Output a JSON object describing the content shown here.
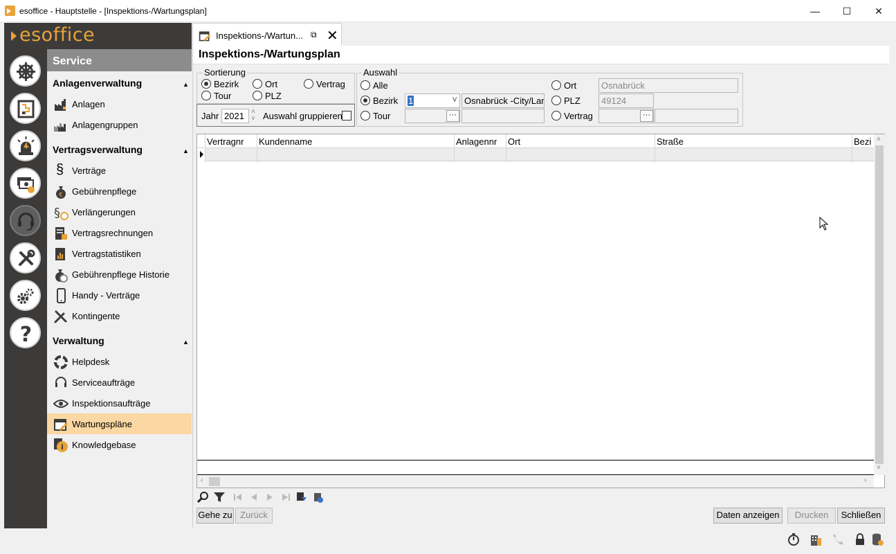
{
  "window": {
    "title": "esoffice - Hauptstelle - [Inspektions-/Wartungsplan]",
    "minimize": "—",
    "maximize": "☐",
    "close": "✕"
  },
  "brand": {
    "logo_text": "esoffice"
  },
  "rail": {
    "icons": [
      "helm-icon",
      "map-icon",
      "alarm-icon",
      "money-icon",
      "headset-icon",
      "tools-icon",
      "gears-icon",
      "help-icon"
    ]
  },
  "sidebar": {
    "section_title": "Service",
    "groups": [
      {
        "title": "Anlagenverwaltung",
        "items": [
          "Anlagen",
          "Anlagengruppen"
        ]
      },
      {
        "title": "Vertragsverwaltung",
        "items": [
          "Verträge",
          "Gebührenpflege",
          "Verlängerungen",
          "Vertragsrechnungen",
          "Vertragstatistiken",
          "Gebührenpflege Historie",
          "Handy - Verträge",
          "Kontingente"
        ]
      },
      {
        "title": "Verwaltung",
        "items": [
          "Helpdesk",
          "Serviceaufträge",
          "Inspektionsaufträge",
          "Wartungspläne",
          "Knowledgebase"
        ]
      }
    ],
    "caret": "▲",
    "section_symbol": "§"
  },
  "tab": {
    "label": "Inspektions-/Wartun...",
    "close": "✕",
    "popout": "⧉"
  },
  "page": {
    "title": "Inspektions-/Wartungsplan"
  },
  "sort": {
    "legend": "Sortierung",
    "options": [
      "Bezirk",
      "Ort",
      "Vertrag",
      "Tour",
      "PLZ"
    ],
    "selected": "Bezirk",
    "year_label": "Jahr",
    "year_value": "2021",
    "group_label": "Auswahl gruppieren"
  },
  "selection": {
    "legend": "Auswahl",
    "alle": "Alle",
    "bezirk": "Bezirk",
    "bezirk_code": "1",
    "bezirk_name": "Osnabrück -City/Lan",
    "tour": "Tour",
    "ort": "Ort",
    "ort_value": "Osnabrück",
    "plz": "PLZ",
    "plz_value": "49124",
    "vertrag": "Vertrag",
    "dots": "···"
  },
  "grid": {
    "columns": [
      "Vertragnr",
      "Kundenname",
      "Anlagennr",
      "Ort",
      "Straße",
      "Bezi"
    ],
    "up": "˄",
    "down": "˅",
    "left": "‹",
    "right": "›"
  },
  "buttons": {
    "goto": "Gehe zu",
    "back": "Zurück",
    "show": "Daten anzeigen",
    "print": "Drucken",
    "close": "Schließen"
  }
}
